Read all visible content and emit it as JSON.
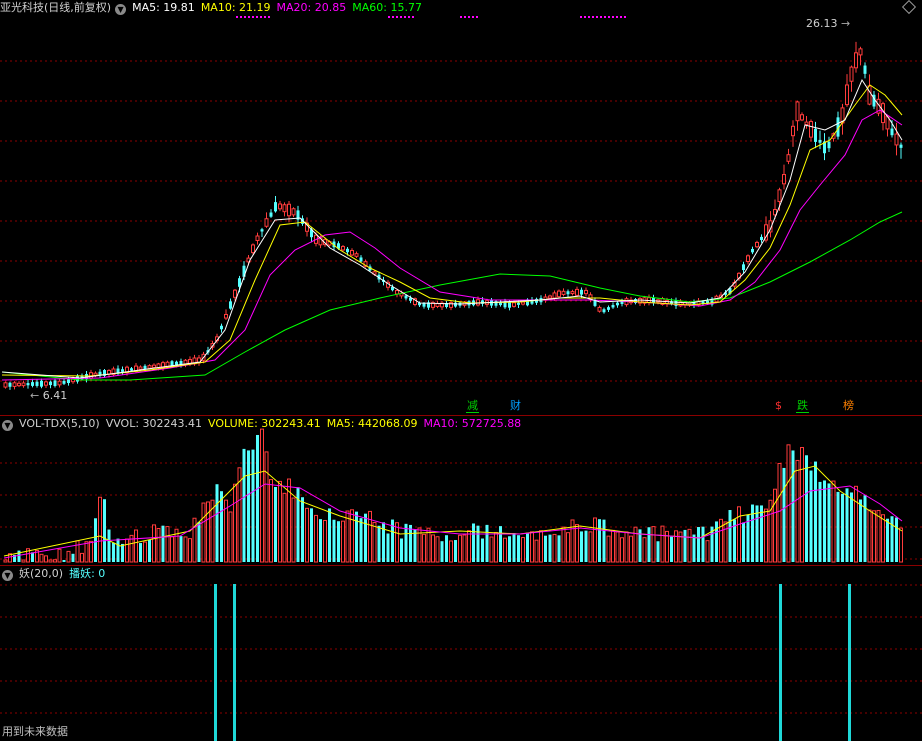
{
  "price_header": {
    "title": "亚光科技(日线,前复权)",
    "ma5": "MA5: 19.81",
    "ma10": "MA10: 21.19",
    "ma20": "MA20: 20.85",
    "ma60": "MA60: 15.77"
  },
  "price_annotations": {
    "high": "26.13",
    "low": "6.41"
  },
  "event_tags": [
    {
      "text": "减",
      "color": "#00d000"
    },
    {
      "text": "财",
      "color": "#00a0ff"
    },
    {
      "text": "$",
      "color": "#ff3030"
    },
    {
      "text": "跌",
      "color": "#00d000"
    },
    {
      "text": "榜",
      "color": "#ff8000"
    }
  ],
  "volume_header": {
    "name": "VOL-TDX(5,10)",
    "vvol": "VVOL: 302243.41",
    "volume": "VOLUME: 302243.41",
    "ma5": "MA5: 442068.09",
    "ma10": "MA10: 572725.88"
  },
  "yao_header": {
    "name": "妖(20,0)",
    "value": "播妖: 0"
  },
  "footer": "用到未来数据",
  "colors": {
    "up": "#ff3c3c",
    "down": "#54ffff",
    "ma5": "#ffffff",
    "ma10": "#ffff00",
    "ma20": "#ff00ff",
    "ma60": "#00ff00",
    "grid": "#8b0000"
  }
}
